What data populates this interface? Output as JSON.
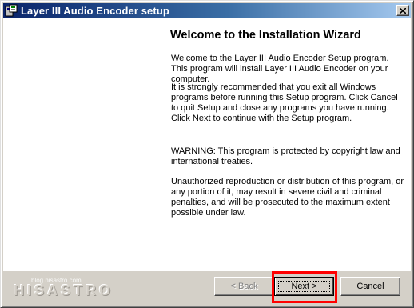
{
  "window": {
    "title": "Layer III Audio Encoder setup",
    "icon": "setup-app-icon"
  },
  "content": {
    "heading": "Welcome to the Installation Wizard",
    "paragraph1": "Welcome to the Layer III Audio Encoder Setup program. This program will install Layer III Audio Encoder on your computer.",
    "paragraph2": "It is strongly recommended that you exit all Windows programs before running this Setup program. Click Cancel to quit Setup and close any programs you have running. Click Next to continue with the Setup program.",
    "paragraph3": "WARNING: This program is protected by copyright law and international treaties.",
    "paragraph4": "Unauthorized reproduction or distribution of this program, or any portion of it, may result in severe civil and criminal penalties, and will be prosecuted to the maximum extent possible under law."
  },
  "buttons": {
    "back": "< Back",
    "next": "Next >",
    "cancel": "Cancel"
  },
  "watermark": {
    "url": "blog.hisastro.com",
    "brand": "HISASTRO"
  },
  "colors": {
    "titlebar_start": "#0a246a",
    "titlebar_end": "#a6caf0",
    "highlight": "#ff0000"
  }
}
